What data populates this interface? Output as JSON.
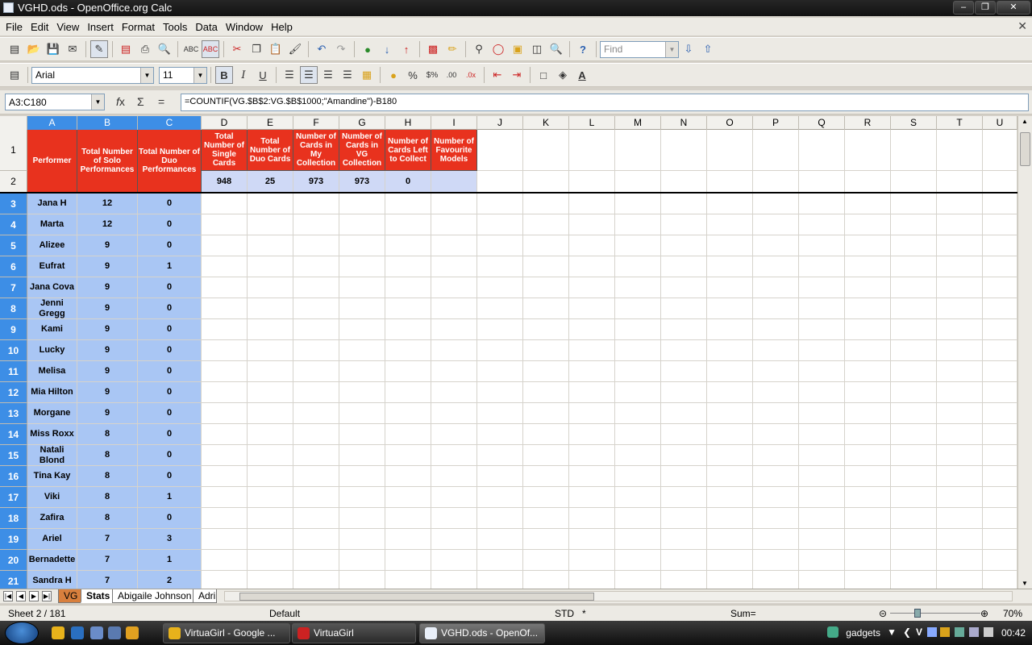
{
  "window": {
    "title": "VGHD.ods - OpenOffice.org Calc"
  },
  "menu": [
    "File",
    "Edit",
    "View",
    "Insert",
    "Format",
    "Tools",
    "Data",
    "Window",
    "Help"
  ],
  "toolbar": {
    "find_placeholder": "Find"
  },
  "format": {
    "font": "Arial",
    "size": "11"
  },
  "formula_bar": {
    "name_box": "A3:C180",
    "formula": "=COUNTIF(VG.$B$2:VG.$B$1000;\"Amandine\")-B180"
  },
  "columns": [
    "A",
    "B",
    "C",
    "D",
    "E",
    "F",
    "G",
    "H",
    "I",
    "J",
    "K",
    "L",
    "M",
    "N",
    "O",
    "P",
    "Q",
    "R",
    "S",
    "T",
    "U"
  ],
  "headers": {
    "A": "Performer",
    "B": "Total Number of Solo Performances",
    "C": "Total Number of Duo Performances",
    "D": "Total Number of Single Cards",
    "E": "Total Number of Duo Cards",
    "F": "Number of Cards in My Collection",
    "G": "Number of Cards in VG Collection",
    "H": "Number of Cards Left to Collect",
    "I": "Number of Favourite Models"
  },
  "totals": {
    "D": "948",
    "E": "25",
    "F": "973",
    "G": "973",
    "H": "0",
    "I": ""
  },
  "rows": [
    {
      "num": "3",
      "name": "Jana H",
      "solo": "12",
      "duo": "0"
    },
    {
      "num": "4",
      "name": "Marta",
      "solo": "12",
      "duo": "0"
    },
    {
      "num": "5",
      "name": "Alizee",
      "solo": "9",
      "duo": "0"
    },
    {
      "num": "6",
      "name": "Eufrat",
      "solo": "9",
      "duo": "1"
    },
    {
      "num": "7",
      "name": "Jana Cova",
      "solo": "9",
      "duo": "0"
    },
    {
      "num": "8",
      "name": "Jenni Gregg",
      "solo": "9",
      "duo": "0"
    },
    {
      "num": "9",
      "name": "Kami",
      "solo": "9",
      "duo": "0"
    },
    {
      "num": "10",
      "name": "Lucky",
      "solo": "9",
      "duo": "0"
    },
    {
      "num": "11",
      "name": "Melisa",
      "solo": "9",
      "duo": "0"
    },
    {
      "num": "12",
      "name": "Mia Hilton",
      "solo": "9",
      "duo": "0"
    },
    {
      "num": "13",
      "name": "Morgane",
      "solo": "9",
      "duo": "0"
    },
    {
      "num": "14",
      "name": "Miss Roxx",
      "solo": "8",
      "duo": "0"
    },
    {
      "num": "15",
      "name": "Natali Blond",
      "solo": "8",
      "duo": "0"
    },
    {
      "num": "16",
      "name": "Tina Kay",
      "solo": "8",
      "duo": "0"
    },
    {
      "num": "17",
      "name": "Viki",
      "solo": "8",
      "duo": "1"
    },
    {
      "num": "18",
      "name": "Zafira",
      "solo": "8",
      "duo": "0"
    },
    {
      "num": "19",
      "name": "Ariel",
      "solo": "7",
      "duo": "3"
    },
    {
      "num": "20",
      "name": "Bernadette",
      "solo": "7",
      "duo": "1"
    },
    {
      "num": "21",
      "name": "Sandra H",
      "solo": "7",
      "duo": "2"
    }
  ],
  "sheet_tabs": [
    "VG",
    "Stats",
    "Abigaile Johnson",
    "Adri"
  ],
  "status": {
    "sheet": "Sheet 2 / 181",
    "style": "Default",
    "mode": "STD",
    "modified": "*",
    "sum": "Sum=",
    "zoom": "70%"
  },
  "taskbar": {
    "tasks": [
      "VirtuaGirl - Google ...",
      "VirtuaGirl",
      "VGHD.ods - OpenOf..."
    ],
    "tray_label": "gadgets",
    "clock": "00:42"
  },
  "colors": {
    "header_red": "#e8321e",
    "selection_blue": "#a9c6f4",
    "total_blue": "#cfd9f6",
    "vg_tab": "#d87f3d"
  }
}
